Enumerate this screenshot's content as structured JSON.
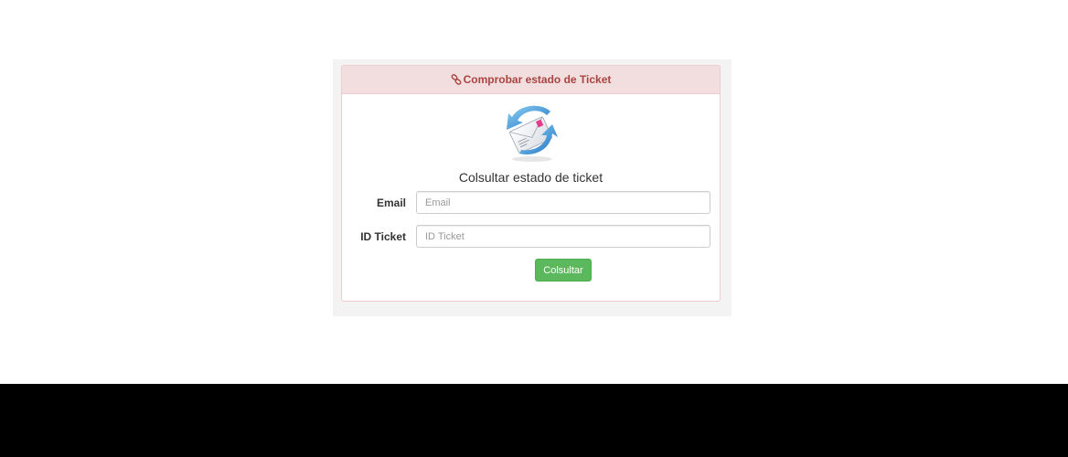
{
  "panel": {
    "title": "Comprobar estado de Ticket",
    "title_icon": "link-icon",
    "image_icon": "mail-refresh-icon",
    "heading": "Colsultar estado de ticket"
  },
  "form": {
    "email_label": "Email",
    "email_placeholder": "Email",
    "email_value": "",
    "ticket_label": "ID Ticket",
    "ticket_placeholder": "ID Ticket",
    "ticket_value": "",
    "submit_label": "Colsultar"
  },
  "colors": {
    "heading_bg": "#f2dede",
    "heading_text": "#a94442",
    "button_bg": "#5cb85c",
    "footer_bg": "#000000"
  }
}
